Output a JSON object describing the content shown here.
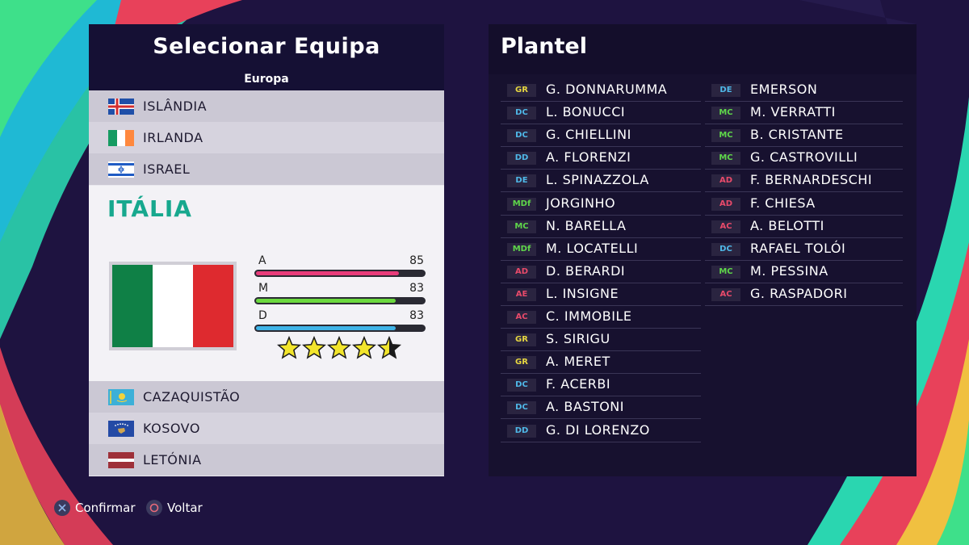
{
  "colors": {
    "attack": "#e83c7a",
    "midfield": "#6bd93e",
    "defense": "#3fb4e8",
    "team_name": "#17a88e",
    "pos_gk": "#e6d640",
    "pos_def": "#4fb8e8",
    "pos_mid": "#5fd64a",
    "pos_att": "#e84a6a"
  },
  "left": {
    "title": "Selecionar Equipa",
    "region": "Europa",
    "countries_above": [
      {
        "name": "ISLÂNDIA",
        "flag": "iceland-flag-icon"
      },
      {
        "name": "IRLANDA",
        "flag": "ireland-flag-icon"
      },
      {
        "name": "ISRAEL",
        "flag": "israel-flag-icon"
      }
    ],
    "selected": {
      "name": "ITÁLIA",
      "flag": "italy-flag-icon",
      "stats": [
        {
          "label": "A",
          "value": 85,
          "color": "attack"
        },
        {
          "label": "M",
          "value": 83,
          "color": "midfield"
        },
        {
          "label": "D",
          "value": 83,
          "color": "defense"
        }
      ],
      "stars": 4.5
    },
    "countries_below": [
      {
        "name": "CAZAQUISTÃO",
        "flag": "kazakhstan-flag-icon"
      },
      {
        "name": "KOSOVO",
        "flag": "kosovo-flag-icon"
      },
      {
        "name": "LETÓNIA",
        "flag": "latvia-flag-icon"
      }
    ]
  },
  "right": {
    "title": "Plantel",
    "col1": [
      {
        "pos": "GR",
        "type": "gk",
        "name": "G. DONNARUMMA"
      },
      {
        "pos": "DC",
        "type": "def",
        "name": "L. BONUCCI"
      },
      {
        "pos": "DC",
        "type": "def",
        "name": "G. CHIELLINI"
      },
      {
        "pos": "DD",
        "type": "def",
        "name": "A. FLORENZI"
      },
      {
        "pos": "DE",
        "type": "def",
        "name": "L. SPINAZZOLA"
      },
      {
        "pos": "MDf",
        "type": "mid",
        "name": "JORGINHO"
      },
      {
        "pos": "MC",
        "type": "mid",
        "name": "N. BARELLA"
      },
      {
        "pos": "MDf",
        "type": "mid",
        "name": "M. LOCATELLI"
      },
      {
        "pos": "AD",
        "type": "att",
        "name": "D. BERARDI"
      },
      {
        "pos": "AE",
        "type": "att",
        "name": "L. INSIGNE"
      },
      {
        "pos": "AC",
        "type": "att",
        "name": "C. IMMOBILE"
      },
      {
        "pos": "GR",
        "type": "gk",
        "name": "S. SIRIGU"
      },
      {
        "pos": "GR",
        "type": "gk",
        "name": "A. MERET"
      },
      {
        "pos": "DC",
        "type": "def",
        "name": "F. ACERBI"
      },
      {
        "pos": "DC",
        "type": "def",
        "name": "A. BASTONI"
      },
      {
        "pos": "DD",
        "type": "def",
        "name": "G. DI LORENZO"
      }
    ],
    "col2": [
      {
        "pos": "DE",
        "type": "def",
        "name": "EMERSON"
      },
      {
        "pos": "MC",
        "type": "mid",
        "name": "M. VERRATTI"
      },
      {
        "pos": "MC",
        "type": "mid",
        "name": "B. CRISTANTE"
      },
      {
        "pos": "MC",
        "type": "mid",
        "name": "G. CASTROVILLI"
      },
      {
        "pos": "AD",
        "type": "att",
        "name": "F. BERNARDESCHI"
      },
      {
        "pos": "AD",
        "type": "att",
        "name": "F. CHIESA"
      },
      {
        "pos": "AC",
        "type": "att",
        "name": "A. BELOTTI"
      },
      {
        "pos": "DC",
        "type": "def",
        "name": "RAFAEL TOLÓI"
      },
      {
        "pos": "MC",
        "type": "mid",
        "name": "M. PESSINA"
      },
      {
        "pos": "AC",
        "type": "att",
        "name": "G. RASPADORI"
      }
    ]
  },
  "hints": {
    "confirm": "Confirmar",
    "confirm_icon": "cross-button-icon",
    "back": "Voltar",
    "back_icon": "circle-button-icon"
  }
}
